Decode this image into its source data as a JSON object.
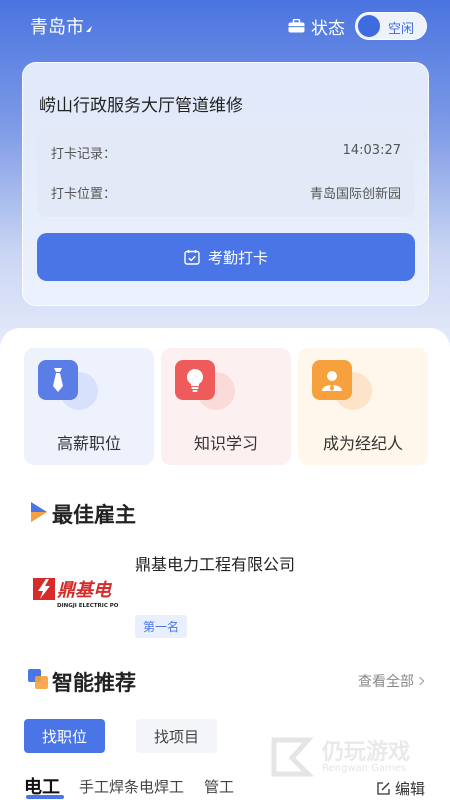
{
  "header": {
    "city": "青岛市",
    "status_label": "状态",
    "toggle_label": "空闲"
  },
  "attendance": {
    "project_title": "崂山行政服务大厅管道维修",
    "record_label": "打卡记录：",
    "record_time": "14:03:27",
    "location_label": "打卡位置：",
    "location_value": "青岛国际创新园",
    "punch_button": "考勤打卡"
  },
  "features": [
    {
      "label": "高薪职位",
      "icon": "tie-icon",
      "color": "#5a7de6"
    },
    {
      "label": "知识学习",
      "icon": "lightbulb-icon",
      "color": "#ef5a5a"
    },
    {
      "label": "成为经纪人",
      "icon": "person-icon",
      "color": "#f6a13e"
    }
  ],
  "best_employer": {
    "title": "最佳雇主",
    "company_name": "鼎基电力工程有限公司",
    "rank": "第一名",
    "logo_text": "鼎基电",
    "logo_sub": "DINGJI ELECTRIC PO"
  },
  "smart_recommend": {
    "title": "智能推荐",
    "view_all": "查看全部",
    "tabs": [
      "找职位",
      "找项目"
    ],
    "categories": [
      "电工",
      "手工焊条电焊工",
      "管工"
    ],
    "edit_label": "编辑"
  },
  "watermark": {
    "title": "仍玩游戏",
    "subtitle": "Rengwan Games"
  },
  "colors": {
    "accent": "#4a75e6",
    "header_bg": "#4a74e0"
  }
}
